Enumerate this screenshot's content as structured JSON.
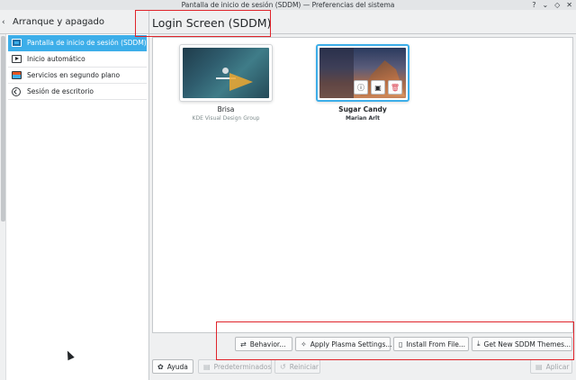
{
  "window": {
    "title": "Pantalla de inicio de sesión (SDDM) — Preferencias del sistema",
    "controls": {
      "help": "?",
      "minimize": "⌄",
      "maximize": "◇",
      "close": "✕"
    }
  },
  "sidebar": {
    "back_icon": "‹",
    "header": "Arranque y apagado",
    "items": [
      {
        "label": "Pantalla de inicio de sesión (SDDM)",
        "icon": "monitor-icon",
        "active": true
      },
      {
        "label": "Inicio automático",
        "icon": "play-icon",
        "active": false
      },
      {
        "label": "Servicios en segundo plano",
        "icon": "services-icon",
        "active": false
      },
      {
        "label": "Sesión de escritorio",
        "icon": "session-icon",
        "active": false
      }
    ]
  },
  "main": {
    "title": "Login Screen (SDDM)",
    "themes": [
      {
        "name": "Brisa",
        "author": "KDE Visual Design Group",
        "selected": false
      },
      {
        "name": "Sugar Candy",
        "author": "Marian Arlt",
        "selected": true
      }
    ],
    "theme_overlay": {
      "info": "ⓘ",
      "preview": "▣",
      "delete": "🗑"
    },
    "actions": {
      "behavior": "Behavior...",
      "apply_plasma": "Apply Plasma Settings...",
      "install_file": "Install From File...",
      "get_new": "Get New SDDM Themes..."
    },
    "action_icons": {
      "behavior": "⇄",
      "apply_plasma": "✧",
      "install_file": "▯",
      "get_new": "⤓"
    }
  },
  "footer": {
    "help": "Ayuda",
    "defaults": "Predeterminados",
    "reset": "Reiniciar",
    "apply": "Aplicar",
    "icons": {
      "help": "✿",
      "defaults": "▤",
      "reset": "↺",
      "apply": "▤"
    }
  },
  "colors": {
    "accent": "#3daee9",
    "highlight_box": "#e0242b"
  }
}
